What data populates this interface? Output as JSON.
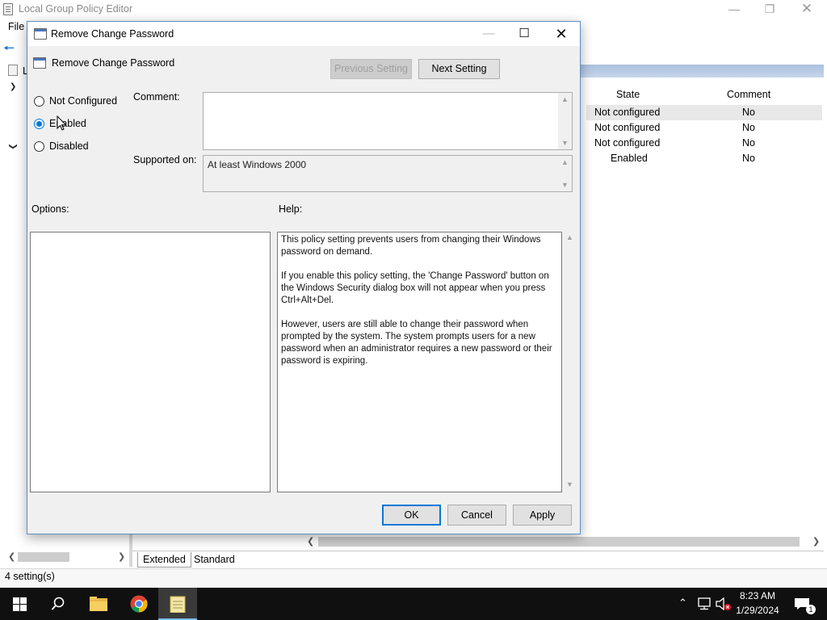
{
  "main_window": {
    "title": "Local Group Policy Editor",
    "menu": {
      "file": "File"
    },
    "tree_truncated_label": "L",
    "list_columns": {
      "state": "State",
      "comment": "Comment"
    },
    "list_rows": [
      {
        "state": "Not configured",
        "comment": "No"
      },
      {
        "state": "Not configured",
        "comment": "No"
      },
      {
        "state": "Not configured",
        "comment": "No"
      },
      {
        "state": "Enabled",
        "comment": "No"
      }
    ],
    "view_tabs": {
      "extended": "Extended",
      "standard": "Standard"
    },
    "status": "4 setting(s)"
  },
  "dialog": {
    "title": "Remove Change Password",
    "setting_name": "Remove Change Password",
    "buttons": {
      "previous": "Previous Setting",
      "next": "Next Setting",
      "ok": "OK",
      "cancel": "Cancel",
      "apply": "Apply"
    },
    "radios": {
      "not_configured": "Not Configured",
      "enabled": "Enabled",
      "disabled": "Disabled",
      "selected": "enabled"
    },
    "labels": {
      "comment": "Comment:",
      "supported_on": "Supported on:",
      "options": "Options:",
      "help": "Help:"
    },
    "comment_value": "",
    "supported_on_value": "At least Windows 2000",
    "help_paragraphs": [
      "This policy setting prevents users from changing their Windows password on demand.",
      "If you enable this policy setting,  the 'Change Password' button on the Windows Security dialog box will not appear when you press Ctrl+Alt+Del.",
      "However, users are still able to change their password when prompted by the system. The system prompts users for a new password when an administrator requires a new password or their password is expiring."
    ]
  },
  "taskbar": {
    "pinned": [
      "start-icon",
      "search-icon",
      "file-explorer-icon",
      "chrome-icon",
      "notepad-icon"
    ],
    "clock_time": "8:23 AM",
    "clock_date": "1/29/2024",
    "notification_count": "1"
  },
  "colors": {
    "accent": "#0078d7",
    "taskbar": "#101010",
    "dialog_bg": "#f0f0f0"
  }
}
